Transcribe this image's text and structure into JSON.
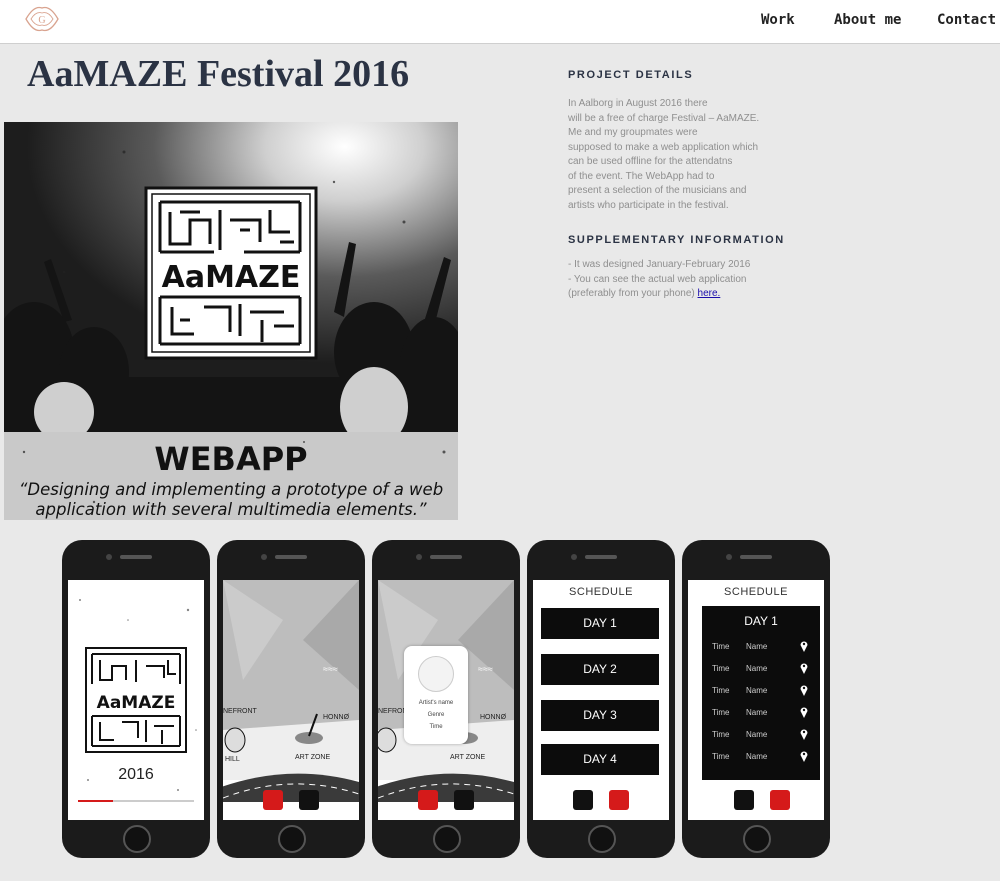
{
  "nav": {
    "logo_letter": "G",
    "links": [
      "Work",
      "About me",
      "Contact"
    ]
  },
  "page": {
    "title": "AaMAZE Festival 2016"
  },
  "hero": {
    "logo_text": "AaMAZE",
    "banner_title": "WEBAPP",
    "banner_quote_line1": "“Designing and implementing a prototype of a web",
    "banner_quote_line2": "application with several multimedia elements.”"
  },
  "project_details": {
    "heading": "PROJECT DETAILS",
    "lines": [
      "In Aalborg in August 2016 there",
      "will be a free of charge Festival – AaMAZE.",
      "Me and my groupmates were",
      "supposed to make a web application which",
      "can be used offline for the attendatns",
      "of the event. The WebApp had to",
      "present a selection of the musicians and",
      "artists who participate in the festival."
    ]
  },
  "supplementary": {
    "heading": "SUPPLEMENTARY INFORMATION",
    "line1": "- It was designed January-February 2016",
    "line2": "- You can see the actual web application",
    "line3_prefix": "(preferably from your phone) ",
    "link_text": "here."
  },
  "phones": {
    "splash": {
      "logo_text": "AaMAZE",
      "year": "2016",
      "progress": 0.3
    },
    "map": {
      "labels": [
        "NEFRONT",
        "HONNØ",
        "HILL",
        "ART ZONE"
      ],
      "wave": "≈≈≈"
    },
    "artist_card": {
      "name": "Artist's name",
      "genre": "Genre",
      "time": "Time"
    },
    "schedule": {
      "title": "SCHEDULE",
      "days": [
        "DAY 1",
        "DAY 2",
        "DAY 3",
        "DAY 4"
      ]
    },
    "day_detail": {
      "title": "SCHEDULE",
      "day": "DAY 1",
      "rows": [
        {
          "time": "Time",
          "name": "Name"
        },
        {
          "time": "Time",
          "name": "Name"
        },
        {
          "time": "Time",
          "name": "Name"
        },
        {
          "time": "Time",
          "name": "Name"
        },
        {
          "time": "Time",
          "name": "Name"
        },
        {
          "time": "Time",
          "name": "Name"
        }
      ]
    }
  },
  "colors": {
    "accent_red": "#d51a1a",
    "title_navy": "#2b3344",
    "logo_pink": "#d9a38f"
  }
}
